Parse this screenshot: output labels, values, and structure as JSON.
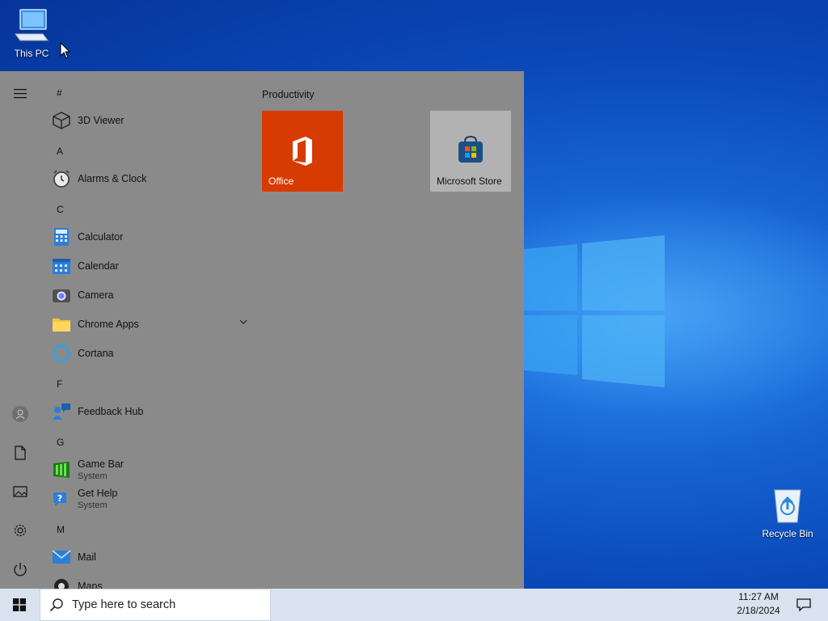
{
  "desktop": {
    "this_pc_label": "This PC",
    "recycle_bin_label": "Recycle Bin"
  },
  "start_menu": {
    "rail_icons": [
      "hamburger-icon",
      "user-icon",
      "document-icon",
      "pictures-icon",
      "gear-icon",
      "power-icon"
    ],
    "letters": [
      "#",
      "A",
      "C",
      "F",
      "G",
      "M"
    ],
    "apps": [
      {
        "name": "3D Viewer",
        "icon": "cube-icon"
      },
      {
        "name": "Alarms & Clock",
        "icon": "alarm-clock-icon"
      },
      {
        "name": "Calculator",
        "icon": "calculator-icon"
      },
      {
        "name": "Calendar",
        "icon": "calendar-icon"
      },
      {
        "name": "Camera",
        "icon": "camera-icon"
      },
      {
        "name": "Chrome Apps",
        "icon": "folder-icon"
      },
      {
        "name": "Cortana",
        "icon": "cortana-icon"
      },
      {
        "name": "Feedback Hub",
        "icon": "feedback-icon"
      },
      {
        "name": "Game Bar",
        "sub": "System",
        "icon": "game-bar-icon"
      },
      {
        "name": "Get Help",
        "sub": "System",
        "icon": "help-icon"
      },
      {
        "name": "Mail",
        "icon": "mail-icon"
      },
      {
        "name": "Maps",
        "icon": "maps-icon"
      }
    ],
    "group_title": "Productivity",
    "tiles": [
      {
        "label": "Office",
        "color": "#d83b01"
      },
      {
        "label": "Microsoft Store",
        "color": "#b2b2b2"
      }
    ]
  },
  "taskbar": {
    "search_placeholder": "Type here to search",
    "time": "11:27 AM",
    "date": "2/18/2024"
  },
  "colors": {
    "accent": "#0a54c9",
    "start_bg": "#8a8a8a",
    "taskbar_bg": "#d8e3ef"
  }
}
